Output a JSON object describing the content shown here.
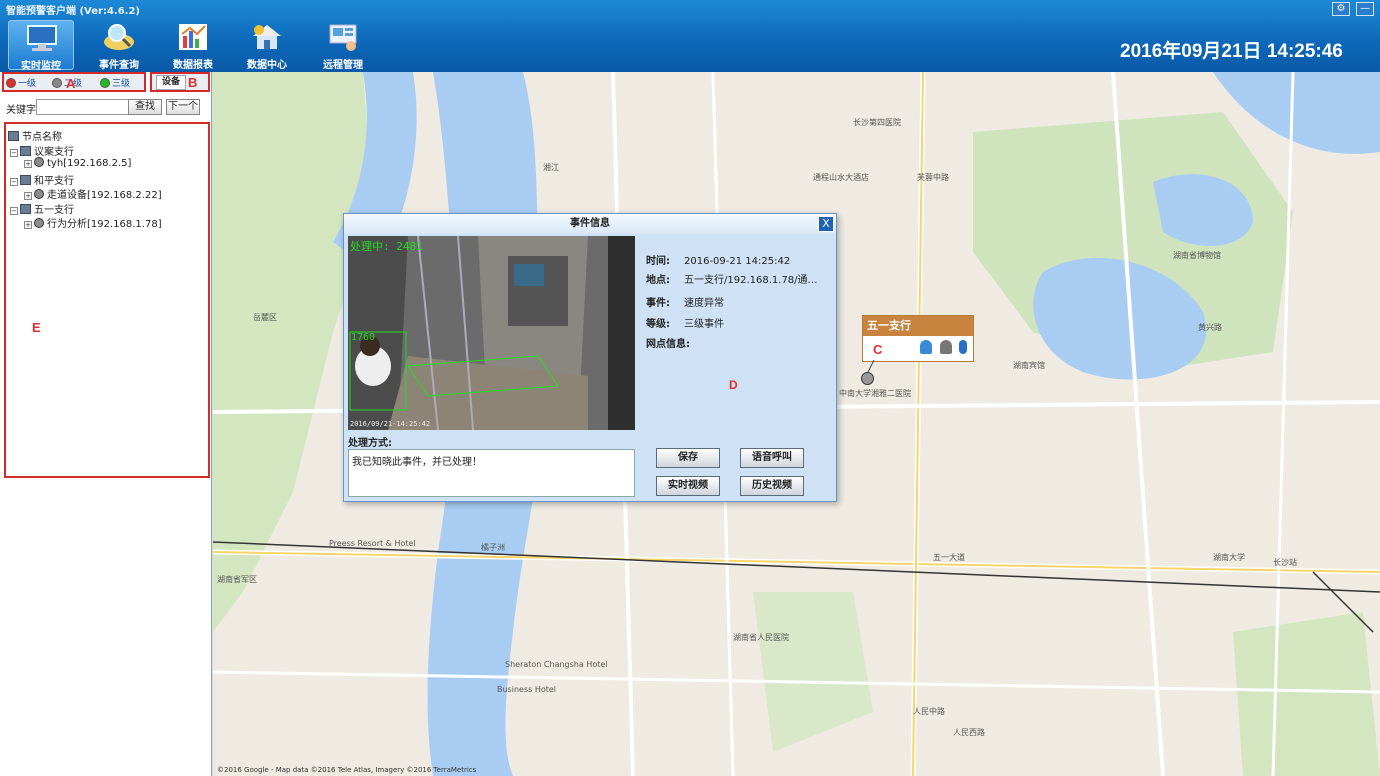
{
  "app": {
    "title": "智能预警客户端 (Ver:4.6.2)",
    "clock": "2016年09月21日 14:25:46"
  },
  "window": {
    "settings_icon": "gear-icon",
    "minimize_icon": "minimize-icon",
    "settings_glyph": "⚙",
    "minimize_glyph": "—"
  },
  "toolbar": {
    "items": [
      {
        "label": "实时监控",
        "icon": "monitor-icon",
        "active": true
      },
      {
        "label": "事件查询",
        "icon": "map-search-icon",
        "active": false
      },
      {
        "label": "数据报表",
        "icon": "chart-icon",
        "active": false
      },
      {
        "label": "数据中心",
        "icon": "house-icon",
        "active": false
      },
      {
        "label": "远程管理",
        "icon": "remote-icon",
        "active": false
      }
    ]
  },
  "left": {
    "levels": [
      {
        "label": "一级",
        "color": "#e03030"
      },
      {
        "label": "二级",
        "color": "#888888"
      },
      {
        "label": "三级",
        "color": "#22bb22"
      }
    ],
    "device_tab": "设备",
    "search_label": "关键字",
    "search_value": "",
    "search_button": "查找",
    "next_button": "下一个",
    "tree": {
      "root": "节点名称",
      "nodes": [
        {
          "name": "议案支行",
          "child": "tyh[192.168.2.5]"
        },
        {
          "name": "和平支行",
          "child": "走道设备[192.168.2.22]"
        },
        {
          "name": "五一支行",
          "child": "行为分析[192.168.1.78]"
        }
      ]
    },
    "expand_glyph": "+",
    "collapse_glyph": "−"
  },
  "annotations": {
    "a": "A",
    "b": "B",
    "c": "C",
    "d": "D",
    "e": "E"
  },
  "dialog": {
    "title": "事件信息",
    "close_glyph": "X",
    "video_status": "处理中: 2481",
    "video_count": "1760",
    "video_timestamp": "2016/09/21-14:25:42",
    "fields": {
      "time_label": "时间:",
      "time_value": "2016-09-21 14:25:42",
      "place_label": "地点:",
      "place_value": "五一支行/192.168.1.78/通…",
      "event_label": "事件:",
      "event_value": "速度异常",
      "level_label": "等级:",
      "level_value": "三级事件",
      "branch_label": "网点信息:"
    },
    "handle_label": "处理方式:",
    "handle_text": "我已知晓此事件，并已处理！",
    "buttons": {
      "save": "保存",
      "voice_call": "语音呼叫",
      "live_video": "实时视频",
      "history_video": "历史视频"
    }
  },
  "map": {
    "popup_title": "五一支行",
    "copyright": "©2016 Google - Map data ©2016 Tele Atlas, Imagery ©2016 TerraMetrics",
    "labels": [
      "湖南大学",
      "湖南省人民医院",
      "五一大道",
      "长沙站",
      "湖南宾馆",
      "湖南省博物馆",
      "黄兴路",
      "芙蓉中路",
      "湘江",
      "橘子洲",
      "岳麓区",
      "长沙第四医院",
      "湖南省军区",
      "通程山水大酒店",
      "Preess Resort & Hotel",
      "Sheraton Changsha Hotel",
      "Business Hotel",
      "中南大学湘雅二医院",
      "人民中路",
      "人民西路"
    ]
  },
  "colors": {
    "accent_blue": "#0d67b8",
    "annotation_red": "#d52a2a",
    "popup_orange": "#c8833f",
    "video_green": "#22dd22"
  }
}
